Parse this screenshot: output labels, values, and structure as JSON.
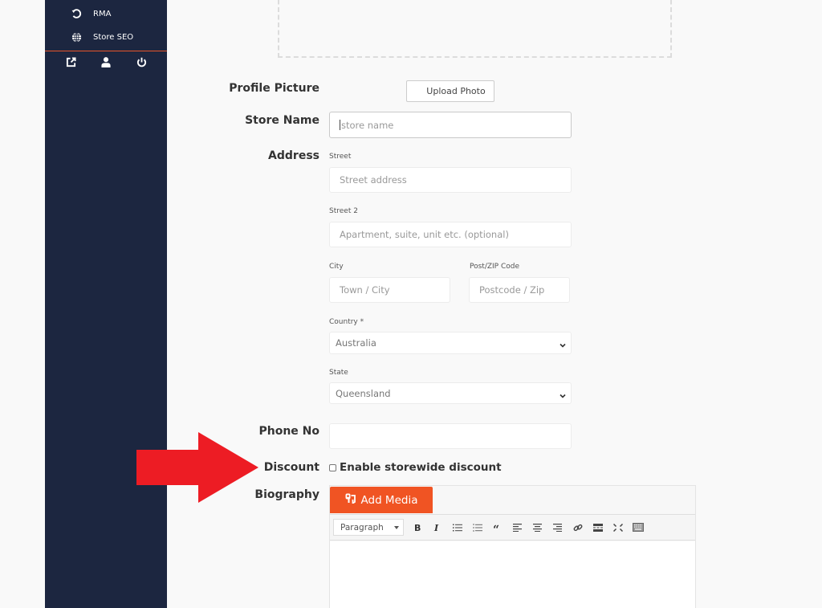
{
  "sidebar": {
    "items": [
      {
        "label": "RMA",
        "icon": "undo-icon"
      },
      {
        "label": "Store SEO",
        "icon": "globe-icon"
      }
    ],
    "bottom_icons": [
      "external-link-icon",
      "user-icon",
      "power-icon"
    ],
    "accent_color": "#e8552a",
    "background_color": "#1c2640"
  },
  "form": {
    "profile_picture": {
      "label": "Profile Picture",
      "button": "Upload Photo"
    },
    "store_name": {
      "label": "Store Name",
      "placeholder": "store name",
      "value": ""
    },
    "address": {
      "label": "Address",
      "street": {
        "label": "Street",
        "placeholder": "Street address"
      },
      "street2": {
        "label": "Street 2",
        "placeholder": "Apartment, suite, unit etc. (optional)"
      },
      "city": {
        "label": "City",
        "placeholder": "Town / City"
      },
      "zip": {
        "label": "Post/ZIP Code",
        "placeholder": "Postcode / Zip"
      },
      "country": {
        "label": "Country *",
        "value": "Australia"
      },
      "state": {
        "label": "State",
        "value": "Queensland"
      }
    },
    "phone": {
      "label": "Phone No",
      "value": ""
    },
    "discount": {
      "label": "Discount",
      "checkbox_label": "Enable storewide discount",
      "checked": false
    },
    "biography": {
      "label": "Biography",
      "add_media": "Add Media",
      "format_select": "Paragraph",
      "toolbar": [
        "Bold",
        "Italic",
        "Bulleted list",
        "Numbered list",
        "Blockquote",
        "Align left",
        "Align center",
        "Align right",
        "Insert link",
        "Read more",
        "Fullscreen",
        "Toolbar toggle"
      ]
    }
  },
  "annotation": {
    "type": "red-arrow",
    "color": "#ed1c24",
    "points_to": "Discount"
  },
  "brand_color": "#f05423"
}
